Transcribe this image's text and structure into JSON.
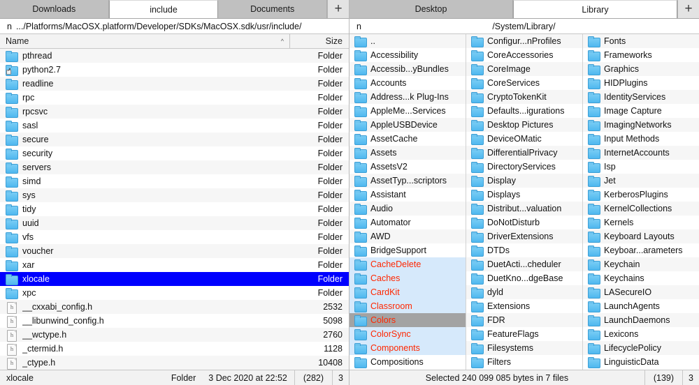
{
  "left": {
    "tabs": [
      {
        "label": "Downloads",
        "active": false
      },
      {
        "label": "include",
        "active": true
      },
      {
        "label": "Documents",
        "active": false
      }
    ],
    "add_tab_label": "+",
    "path_drive": "n",
    "path": ".../Platforms/MacOSX.platform/Developer/SDKs/MacOSX.sdk/usr/include/",
    "columns": {
      "name": "Name",
      "size": "Size",
      "sort_arrow": "^"
    },
    "rows": [
      {
        "name": "pthread",
        "size": "Folder",
        "icon": "folder-icon"
      },
      {
        "name": "python2.7",
        "size": "Folder",
        "icon": "folder-alias-icon"
      },
      {
        "name": "readline",
        "size": "Folder",
        "icon": "folder-icon"
      },
      {
        "name": "rpc",
        "size": "Folder",
        "icon": "folder-icon"
      },
      {
        "name": "rpcsvc",
        "size": "Folder",
        "icon": "folder-icon"
      },
      {
        "name": "sasl",
        "size": "Folder",
        "icon": "folder-icon"
      },
      {
        "name": "secure",
        "size": "Folder",
        "icon": "folder-icon"
      },
      {
        "name": "security",
        "size": "Folder",
        "icon": "folder-icon"
      },
      {
        "name": "servers",
        "size": "Folder",
        "icon": "folder-icon"
      },
      {
        "name": "simd",
        "size": "Folder",
        "icon": "folder-icon"
      },
      {
        "name": "sys",
        "size": "Folder",
        "icon": "folder-icon"
      },
      {
        "name": "tidy",
        "size": "Folder",
        "icon": "folder-icon"
      },
      {
        "name": "uuid",
        "size": "Folder",
        "icon": "folder-icon"
      },
      {
        "name": "vfs",
        "size": "Folder",
        "icon": "folder-icon"
      },
      {
        "name": "voucher",
        "size": "Folder",
        "icon": "folder-icon"
      },
      {
        "name": "xar",
        "size": "Folder",
        "icon": "folder-icon"
      },
      {
        "name": "xlocale",
        "size": "Folder",
        "icon": "folder-icon",
        "cursor": true
      },
      {
        "name": "xpc",
        "size": "Folder",
        "icon": "folder-icon"
      },
      {
        "name": "__cxxabi_config.h",
        "size": "2532",
        "icon": "h-file-icon",
        "glyph": "h"
      },
      {
        "name": "__libunwind_config.h",
        "size": "5098",
        "icon": "h-file-icon",
        "glyph": "h"
      },
      {
        "name": "__wctype.h",
        "size": "2760",
        "icon": "h-file-icon",
        "glyph": "h"
      },
      {
        "name": "_ctermid.h",
        "size": "1128",
        "icon": "h-file-icon",
        "glyph": "h"
      },
      {
        "name": "_ctype.h",
        "size": "10408",
        "icon": "h-file-icon",
        "glyph": "h"
      }
    ],
    "status": {
      "name": "xlocale",
      "type": "Folder",
      "date": "3 Dec 2020 at 22:52",
      "count": "(282)",
      "extra": "3"
    }
  },
  "right": {
    "tabs": [
      {
        "label": "Desktop",
        "active": false
      },
      {
        "label": "Library",
        "active": true
      }
    ],
    "add_tab_label": "+",
    "path_drive": "n",
    "path": "/System/Library/",
    "columns": [
      [
        {
          "name": "..",
          "icon": "folder-up-icon"
        },
        {
          "name": "Accessibility",
          "icon": "folder-icon"
        },
        {
          "name": "Accessib...yBundles",
          "icon": "folder-icon"
        },
        {
          "name": "Accounts",
          "icon": "folder-icon"
        },
        {
          "name": "Address...k Plug-Ins",
          "icon": "folder-icon"
        },
        {
          "name": "AppleMe...Services",
          "icon": "folder-icon"
        },
        {
          "name": "AppleUSBDevice",
          "icon": "folder-icon"
        },
        {
          "name": "AssetCache",
          "icon": "folder-icon"
        },
        {
          "name": "Assets",
          "icon": "folder-icon"
        },
        {
          "name": "AssetsV2",
          "icon": "folder-icon"
        },
        {
          "name": "AssetTyp...scriptors",
          "icon": "folder-icon"
        },
        {
          "name": "Assistant",
          "icon": "folder-icon"
        },
        {
          "name": "Audio",
          "icon": "folder-icon"
        },
        {
          "name": "Automator",
          "icon": "folder-icon"
        },
        {
          "name": "AWD",
          "icon": "folder-icon"
        },
        {
          "name": "BridgeSupport",
          "icon": "folder-icon"
        },
        {
          "name": "CacheDelete",
          "icon": "folder-icon",
          "marked": true
        },
        {
          "name": "Caches",
          "icon": "folder-icon",
          "marked": true
        },
        {
          "name": "CardKit",
          "icon": "folder-icon",
          "marked": true
        },
        {
          "name": "Classroom",
          "icon": "folder-icon",
          "marked": true
        },
        {
          "name": "Colors",
          "icon": "folder-icon",
          "marked": true,
          "cursor": true
        },
        {
          "name": "ColorSync",
          "icon": "folder-icon",
          "marked": true
        },
        {
          "name": "Components",
          "icon": "folder-icon",
          "marked": true
        },
        {
          "name": "Compositions",
          "icon": "folder-icon"
        }
      ],
      [
        {
          "name": "Configur...nProfiles",
          "icon": "folder-icon"
        },
        {
          "name": "CoreAccessories",
          "icon": "folder-icon"
        },
        {
          "name": "CoreImage",
          "icon": "folder-icon"
        },
        {
          "name": "CoreServices",
          "icon": "folder-icon"
        },
        {
          "name": "CryptoTokenKit",
          "icon": "folder-icon"
        },
        {
          "name": "Defaults...igurations",
          "icon": "folder-icon"
        },
        {
          "name": "Desktop Pictures",
          "icon": "folder-icon"
        },
        {
          "name": "DeviceOMatic",
          "icon": "folder-icon"
        },
        {
          "name": "DifferentialPrivacy",
          "icon": "folder-icon"
        },
        {
          "name": "DirectoryServices",
          "icon": "folder-icon"
        },
        {
          "name": "Display",
          "icon": "folder-icon"
        },
        {
          "name": "Displays",
          "icon": "folder-icon"
        },
        {
          "name": "Distribut...valuation",
          "icon": "folder-icon"
        },
        {
          "name": "DoNotDisturb",
          "icon": "folder-icon"
        },
        {
          "name": "DriverExtensions",
          "icon": "folder-icon"
        },
        {
          "name": "DTDs",
          "icon": "folder-icon"
        },
        {
          "name": "DuetActi...cheduler",
          "icon": "folder-icon"
        },
        {
          "name": "DuetKno...dgeBase",
          "icon": "folder-icon"
        },
        {
          "name": "dyld",
          "icon": "folder-icon"
        },
        {
          "name": "Extensions",
          "icon": "folder-icon"
        },
        {
          "name": "FDR",
          "icon": "folder-icon"
        },
        {
          "name": "FeatureFlags",
          "icon": "folder-icon"
        },
        {
          "name": "Filesystems",
          "icon": "folder-icon"
        },
        {
          "name": "Filters",
          "icon": "folder-icon"
        }
      ],
      [
        {
          "name": "Fonts",
          "icon": "folder-icon"
        },
        {
          "name": "Frameworks",
          "icon": "folder-icon"
        },
        {
          "name": "Graphics",
          "icon": "folder-icon"
        },
        {
          "name": "HIDPlugins",
          "icon": "folder-icon"
        },
        {
          "name": "IdentityServices",
          "icon": "folder-icon"
        },
        {
          "name": "Image Capture",
          "icon": "folder-icon"
        },
        {
          "name": "ImagingNetworks",
          "icon": "folder-icon"
        },
        {
          "name": "Input Methods",
          "icon": "folder-icon"
        },
        {
          "name": "InternetAccounts",
          "icon": "folder-icon"
        },
        {
          "name": "Isp",
          "icon": "folder-icon"
        },
        {
          "name": "Jet",
          "icon": "folder-icon"
        },
        {
          "name": "KerberosPlugins",
          "icon": "folder-icon"
        },
        {
          "name": "KernelCollections",
          "icon": "folder-icon"
        },
        {
          "name": "Kernels",
          "icon": "folder-icon"
        },
        {
          "name": "Keyboard Layouts",
          "icon": "folder-icon"
        },
        {
          "name": "Keyboar...arameters",
          "icon": "folder-icon"
        },
        {
          "name": "Keychain",
          "icon": "folder-icon"
        },
        {
          "name": "Keychains",
          "icon": "folder-icon"
        },
        {
          "name": "LASecureIO",
          "icon": "folder-icon"
        },
        {
          "name": "LaunchAgents",
          "icon": "folder-icon"
        },
        {
          "name": "LaunchDaemons",
          "icon": "folder-icon"
        },
        {
          "name": "Lexicons",
          "icon": "folder-icon"
        },
        {
          "name": "LifecyclePolicy",
          "icon": "folder-icon"
        },
        {
          "name": "LinguisticData",
          "icon": "folder-icon"
        }
      ]
    ],
    "status": {
      "message": "Selected 240 099 085 bytes in 7 files",
      "count": "(139)",
      "extra": "3"
    }
  },
  "colors": {
    "marked_text": "#ff2600",
    "marked_bg": "#d6e9fb",
    "cursor_bg": "#0000ff",
    "cursor_gray_bg": "#a3a3a3",
    "folder_icon": "#4fb8ef"
  }
}
